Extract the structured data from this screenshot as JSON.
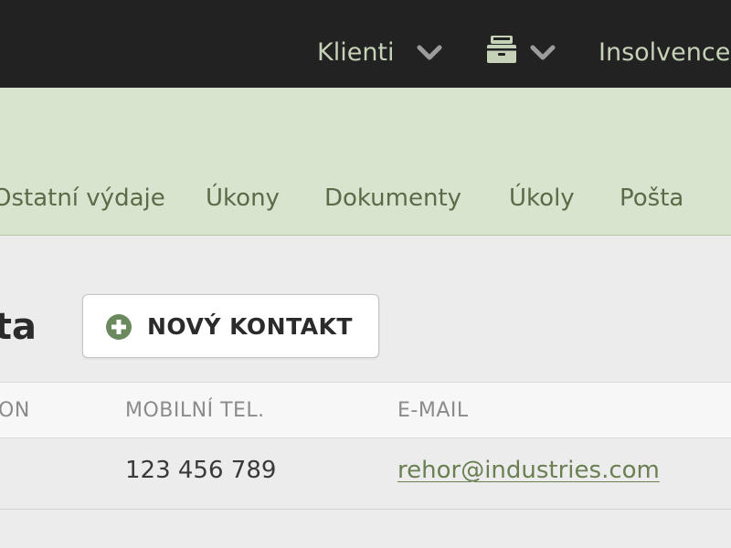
{
  "topbar": {
    "clients_label": "Klienti",
    "insolvence_label": "Insolvence",
    "icons": [
      "chevron-down-icon",
      "cabinet-icon"
    ],
    "text_color": "#c6d2b8"
  },
  "subnav": {
    "tabs": [
      {
        "label": "Ostatní výdaje"
      },
      {
        "label": "Úkony"
      },
      {
        "label": "Dokumenty"
      },
      {
        "label": "Úkoly"
      },
      {
        "label": "Pošta"
      }
    ],
    "background": "#d9e4ce"
  },
  "main": {
    "heading_partial": "ta",
    "new_contact_label": "NOVÝ KONTAKT"
  },
  "table": {
    "columns": [
      "ON",
      "MOBILNÍ TEL.",
      "E-MAIL"
    ],
    "rows": [
      {
        "phone": "123 456 789",
        "email": "rehor@industries.com"
      }
    ]
  },
  "colors": {
    "accent_green": "#6a8a5e",
    "link_green": "#6a7f52"
  }
}
